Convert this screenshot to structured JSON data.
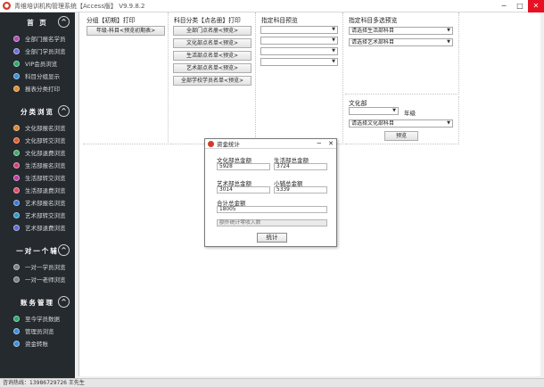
{
  "window": {
    "title": "青维培训机构管理系统【Access版】 V9.9.8.2",
    "minimize": "─",
    "maximize": "□",
    "close": "✕"
  },
  "sidebar": {
    "sections": [
      {
        "title": "首 页",
        "toggle": "^",
        "items": [
          {
            "label": "全部门报名学员",
            "color": "#b04ab8"
          },
          {
            "label": "全部门学员浏览",
            "color": "#6d6dd6"
          },
          {
            "label": "VIP会员浏览",
            "color": "#2aa870"
          },
          {
            "label": "科目分组显示",
            "color": "#3a8fd8"
          },
          {
            "label": "报表分类打印",
            "color": "#e0902a"
          }
        ]
      },
      {
        "title": "分类浏览",
        "toggle": "^",
        "items": [
          {
            "label": "文化部报名浏览",
            "color": "#d9852a"
          },
          {
            "label": "文化部转交浏览",
            "color": "#e25a2a"
          },
          {
            "label": "文化部退费浏览",
            "color": "#3cab6a"
          },
          {
            "label": "生活部报名浏览",
            "color": "#d43e7a"
          },
          {
            "label": "生活部转交浏览",
            "color": "#c03aa0"
          },
          {
            "label": "生活部退费浏览",
            "color": "#d84c6c"
          },
          {
            "label": "艺术部报名浏览",
            "color": "#3a78d4"
          },
          {
            "label": "艺术部转交浏览",
            "color": "#2f9ac8"
          },
          {
            "label": "艺术部退费浏览",
            "color": "#5a6ad0"
          }
        ]
      },
      {
        "title": "一对一个辅",
        "toggle": "^",
        "items": [
          {
            "label": "一对一学员浏览",
            "color": "#7a7f86"
          },
          {
            "label": "一对一老师浏览",
            "color": "#7a7f86"
          }
        ]
      },
      {
        "title": "账务管理",
        "toggle": "^",
        "items": [
          {
            "label": "至今学员数据",
            "color": "#2aa870"
          },
          {
            "label": "管理员浏览",
            "color": "#3a8fd8"
          },
          {
            "label": "资金转账",
            "color": "#3a8fd8"
          }
        ]
      }
    ]
  },
  "status": {
    "text": "咨询热线：13986729726 王先生"
  },
  "panels": {
    "grade": {
      "title": "分组【初期】打印",
      "button": "年级-科目<预览初期表>"
    },
    "subject": {
      "title": "科目分类【点名册】打印",
      "buttons": [
        "全部门点名册<预览>",
        "文化部点名单<预览>",
        "生活部点名单<预览>",
        "艺术部点名单<预览>",
        "全部学校学员名单<预览>"
      ]
    },
    "specified": {
      "title": "指定科目预览"
    },
    "multi": {
      "title": "指定科目多选预览",
      "combo1": "请选择生活部科目",
      "combo2": "请选择艺术部科目"
    },
    "culture": {
      "title": "文化部",
      "grade_label": "年级",
      "combo": "请选择文化部科目",
      "button": "预览"
    }
  },
  "dialog": {
    "title": "资金统计",
    "min": "─",
    "close": "✕",
    "culture_label": "文化部总金额",
    "culture_value": "5928",
    "life_label": "生活部总金额",
    "life_value": "3724",
    "art_label": "艺术部总金额",
    "art_value": "3014",
    "tutor_label": "小辅总金额",
    "tutor_value": "5339",
    "total_label": "合计总金额",
    "total_value": "18005",
    "hint": "额外统计零收入数",
    "button": "统计"
  }
}
